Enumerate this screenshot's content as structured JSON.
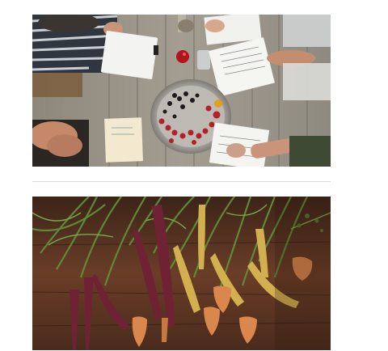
{
  "gallery": {
    "items": [
      {
        "id": "table-photo",
        "subject": "overhead-table",
        "colors": {
          "wood": "#9a948a",
          "plate": "#b8b5ae",
          "berries": "#b3202a"
        }
      },
      {
        "id": "carrot-photo",
        "subject": "heirloom-carrots",
        "colors": {
          "board": "#5a3322",
          "greens": "#4f7a32",
          "orange": "#d9874d",
          "purple": "#6e2234"
        }
      }
    ],
    "divider_color": "#d9d9d9"
  }
}
